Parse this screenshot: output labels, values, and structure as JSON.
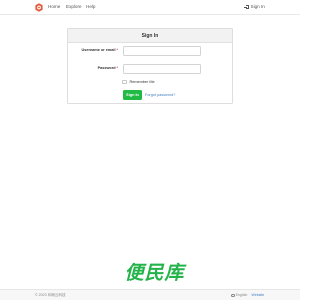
{
  "navbar": {
    "links": [
      {
        "label": "Home"
      },
      {
        "label": "Explore"
      },
      {
        "label": "Help"
      }
    ],
    "signin_label": "Sign In"
  },
  "signin_form": {
    "title": "Sign In",
    "username_label": "Username or email",
    "password_label": "Password",
    "required_mark": "*",
    "username_value": "",
    "password_value": "",
    "remember_label": "Remember Me",
    "remember_checked": false,
    "submit_label": "Sign In",
    "forgot_label": "Forgot password?"
  },
  "watermark": {
    "text": "便民库"
  },
  "footer": {
    "copyright": "© 2023 印刷云科技",
    "language": "English",
    "website_label": "Website"
  },
  "colors": {
    "primary_green": "#21ba45",
    "link_blue": "#4183c4",
    "logo_red": "#e55a3b",
    "watermark_green": "#23b34a"
  },
  "icons": {
    "logo": "gitea-style-logo-icon",
    "signin": "sign-in-icon",
    "language": "globe-icon"
  }
}
